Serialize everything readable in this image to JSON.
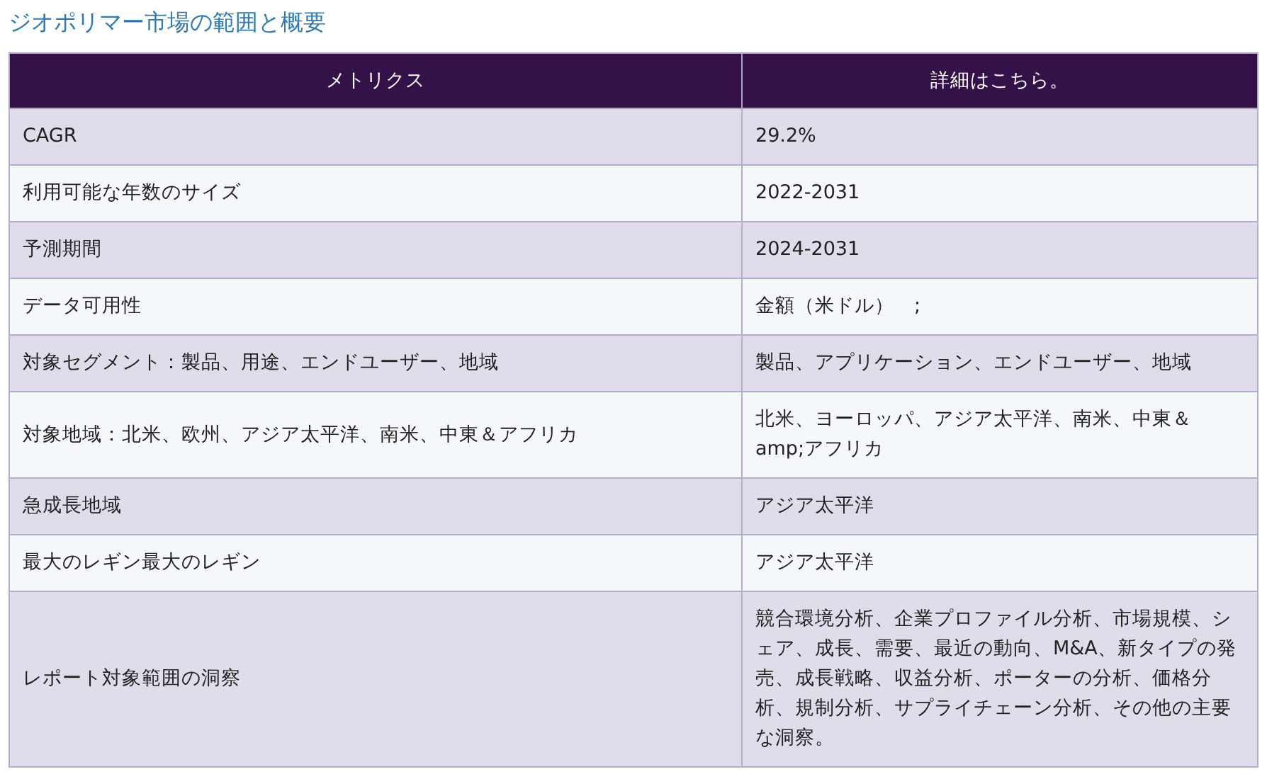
{
  "title": "ジオポリマー市場の範囲と概要",
  "table": {
    "columns": [
      "メトリクス",
      "詳細はこちら。"
    ],
    "rows": [
      [
        "CAGR",
        "29.2%"
      ],
      [
        "利用可能な年数のサイズ",
        "2022-2031"
      ],
      [
        "予測期間",
        "2024-2031"
      ],
      [
        "データ可用性",
        "金額（米ドル）　;"
      ],
      [
        "対象セグメント：製品、用途、エンドユーザー、地域",
        "製品、アプリケーション、エンドユーザー、地域"
      ],
      [
        "対象地域：北米、欧州、アジア太平洋、南米、中東＆アフリカ",
        "北米、ヨーロッパ、アジア太平洋、南米、中東＆amp;アフリカ"
      ],
      [
        "急成長地域",
        "アジア太平洋"
      ],
      [
        "最大のレギン最大のレギン",
        "アジア太平洋"
      ],
      [
        "レポート対象範囲の洞察",
        "競合環境分析、企業プロファイル分析、市場規模、シェア、成長、需要、最近の動向、M&A、新タイプの発売、成長戦略、収益分析、ポーターの分析、価格分析、規制分析、サプライチェーン分析、その他の主要な洞察。"
      ]
    ]
  }
}
